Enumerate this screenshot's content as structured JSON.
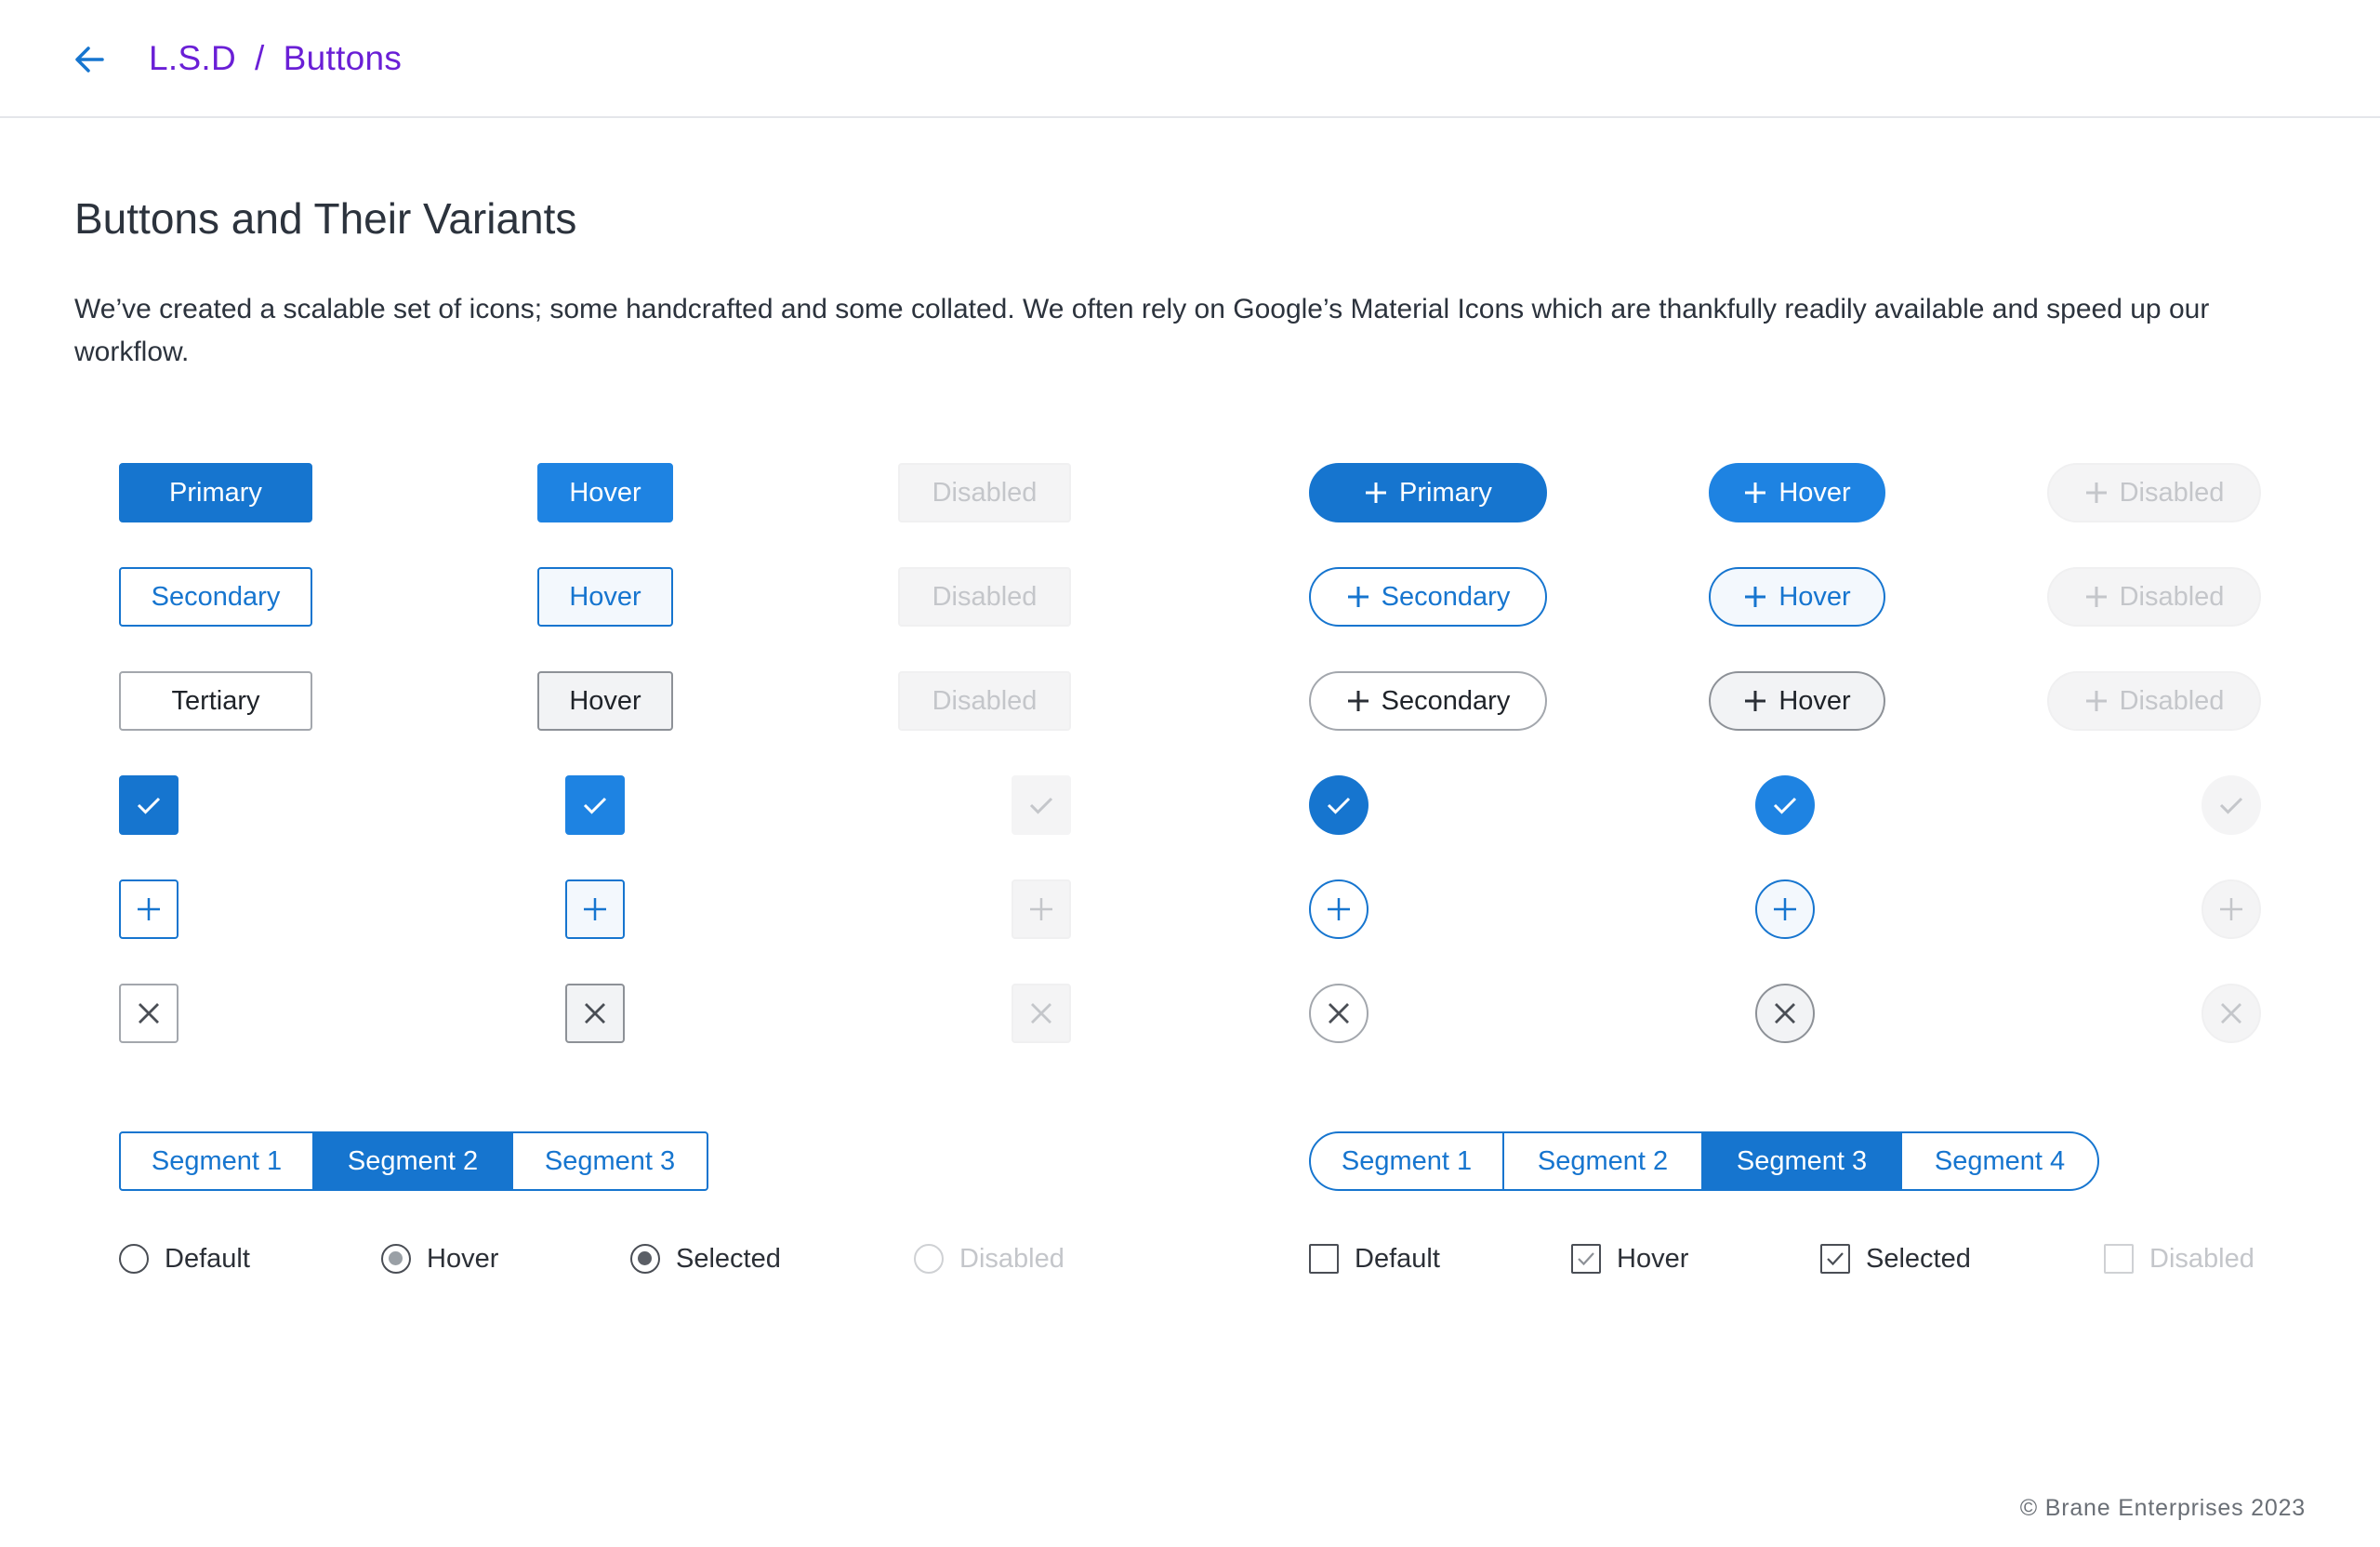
{
  "header": {
    "root": "L.S.D",
    "separator": "/",
    "current": "Buttons"
  },
  "page": {
    "title": "Buttons and Their Variants",
    "description": "We’ve created a scalable set of icons; some handcrafted and some collated. We often rely on Google’s Material Icons which are thankfully readily available and speed up our workflow."
  },
  "square_buttons": {
    "primary": {
      "default": "Primary",
      "hover": "Hover",
      "disabled": "Disabled"
    },
    "secondary": {
      "default": "Secondary",
      "hover": "Hover",
      "disabled": "Disabled"
    },
    "tertiary": {
      "default": "Tertiary",
      "hover": "Hover",
      "disabled": "Disabled"
    }
  },
  "pill_buttons": {
    "primary": {
      "default": "Primary",
      "hover": "Hover",
      "disabled": "Disabled"
    },
    "secondary": {
      "default": "Secondary",
      "hover": "Hover",
      "disabled": "Disabled"
    },
    "tertiary": {
      "default": "Secondary",
      "hover": "Hover",
      "disabled": "Disabled"
    }
  },
  "icon_buttons": {
    "rows": [
      "check-icon",
      "plus-icon",
      "close-icon"
    ],
    "states": [
      "default",
      "hover",
      "disabled"
    ]
  },
  "segmented_square": {
    "segments": [
      "Segment 1",
      "Segment 2",
      "Segment 3"
    ],
    "selected": "Segment 2"
  },
  "segmented_pill": {
    "segments": [
      "Segment 1",
      "Segment 2",
      "Segment 3",
      "Segment 4"
    ],
    "selected": "Segment 3"
  },
  "radios": {
    "default": "Default",
    "hover": "Hover",
    "selected": "Selected",
    "disabled": "Disabled"
  },
  "checkboxes": {
    "default": "Default",
    "hover": "Hover",
    "selected": "Selected",
    "disabled": "Disabled"
  },
  "colors": {
    "accent": "#1675cf",
    "accent_hover": "#1e83e2",
    "breadcrumb": "#6a1fd6",
    "disabled_bg": "#f4f4f5",
    "disabled_text": "#c4c6ca"
  },
  "footer": {
    "copyright": "© Brane Enterprises 2023"
  }
}
